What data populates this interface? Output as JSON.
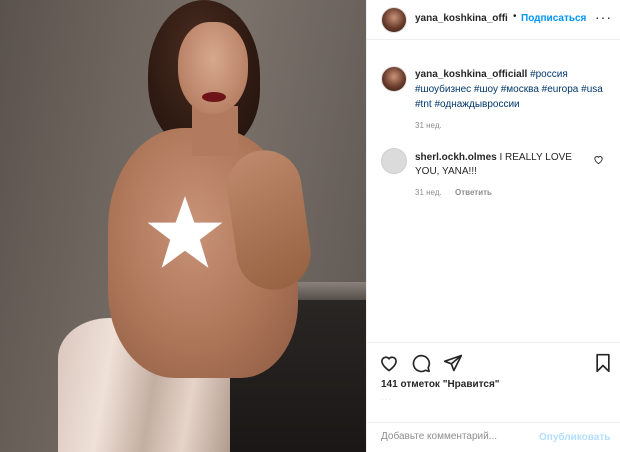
{
  "header": {
    "username": "yana_koshkina_offi",
    "dot": "•",
    "follow_label": "Подписаться",
    "more_label": "···"
  },
  "caption": {
    "username": "yana_koshkina_officiall",
    "hashtags": [
      "#россия",
      "#шоубизнес",
      "#шоу",
      "#москва",
      "#europa",
      "#usa",
      "#tnt",
      "#однаждывроссии"
    ],
    "timestamp": "31 нед."
  },
  "comment": {
    "username": "sherl.ockh.olmes",
    "text": "I REALLY LOVE YOU, YANA!!!",
    "timestamp": "31 нед.",
    "reply_label": "Ответить"
  },
  "actions": {
    "likes_text": "141 отметок \"Нравится\"",
    "faint_text": "· · ·"
  },
  "add_comment": {
    "placeholder": "Добавьте комментарий...",
    "publish_label": "Опубликовать"
  },
  "icons": [
    "heart-icon",
    "comment-bubble-icon",
    "share-paper-plane-icon",
    "bookmark-icon",
    "star-censor-icon",
    "more-dots-icon"
  ]
}
